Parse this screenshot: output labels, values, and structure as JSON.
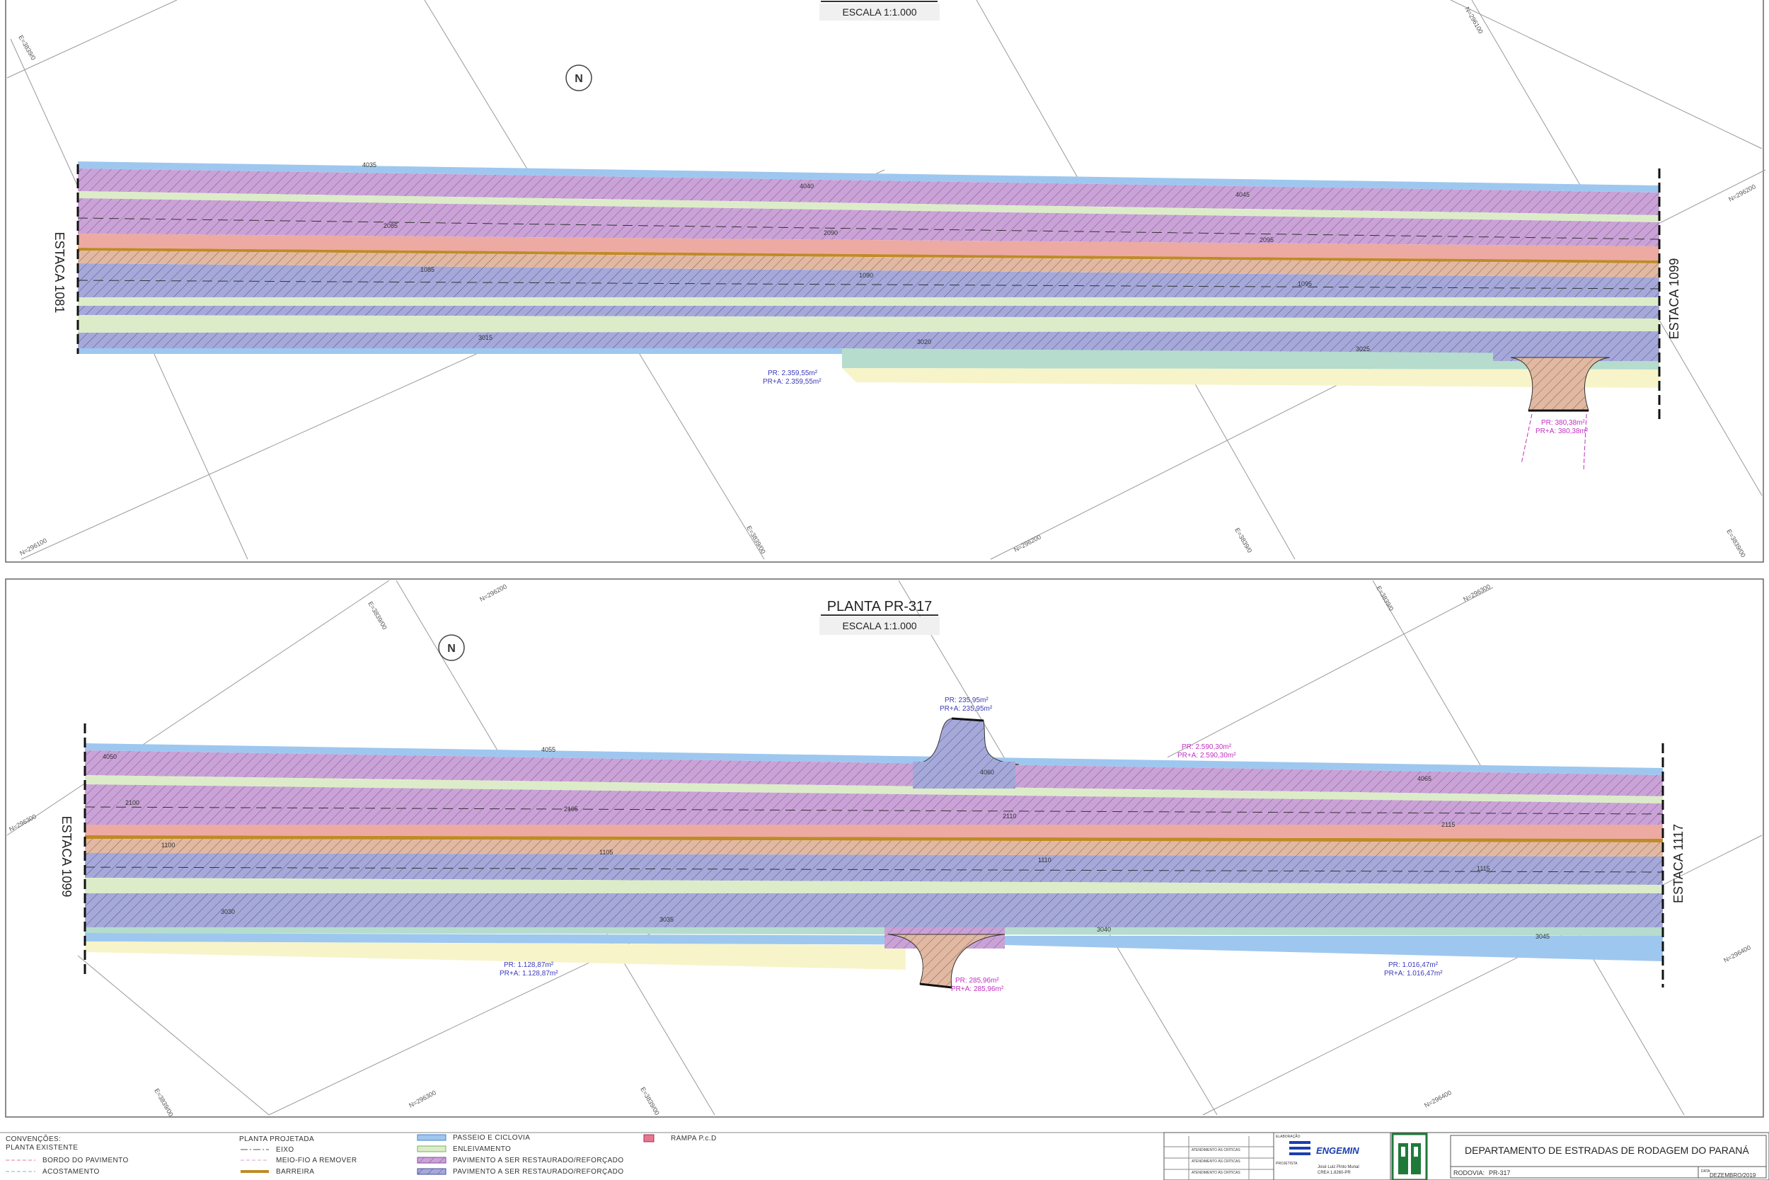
{
  "top_panel": {
    "title": "",
    "scale": "ESCALA  1:1.000",
    "left_station": "ESTACA 1081",
    "right_station": "ESTACA 1099",
    "stake_labels": [
      "4035",
      "4040",
      "4045",
      "2085",
      "2090",
      "2095",
      "1085",
      "1090",
      "1095",
      "3015",
      "3020",
      "3025"
    ],
    "area_blue": [
      "PR:  2.359,55m²",
      "PR+A:  2.359,55m²"
    ],
    "area_magenta": [
      "PR:  380,38m²",
      "PR+A:  380,38m²"
    ],
    "grid_labels": [
      "E=3839/0",
      "N=296200",
      "N=296100",
      "E=3839/00",
      "N=296200",
      "E=3839/0",
      "E=3839/00",
      "N=296100"
    ]
  },
  "bottom_panel": {
    "title": "PLANTA PR-317",
    "scale": "ESCALA  1:1.000",
    "left_station": "ESTACA 1099",
    "right_station": "ESTACA 1117",
    "stake_labels": [
      "4050",
      "4055",
      "4060",
      "4065",
      "2100",
      "2105",
      "2110",
      "2115",
      "1100",
      "1105",
      "1110",
      "1115",
      "3030",
      "3035",
      "3040",
      "3045"
    ],
    "area_top_blue": [
      "PR:  235,95m²",
      "PR+A:  235,95m²"
    ],
    "area_mid_magenta": [
      "PR:  2.590,30m²",
      "PR+A:  2.590,30m²"
    ],
    "area_left_blue": [
      "PR:  1.128,87m²",
      "PR+A:  1.128,87m²"
    ],
    "area_center_magenta": [
      "PR:  285,96m²",
      "PR+A:  285,96m²"
    ],
    "area_right_blue": [
      "PR:  1.016,47m²",
      "PR+A:  1.016,47m²"
    ],
    "grid_labels": [
      "E=3839/00",
      "N=296200",
      "E=3839/0",
      "N=296300",
      "N=296300",
      "N=296400",
      "E=3839/00",
      "N=296300",
      "E=3839/00",
      "N=296400"
    ]
  },
  "legend": {
    "existing_title": [
      "CONVENÇÕES:",
      "PLANTA  EXISTENTE"
    ],
    "existing_items": [
      "BORDO  DO  PAVIMENTO",
      "ACOSTAMENTO"
    ],
    "projected_title": "PLANTA  PROJETADA",
    "projected_items": [
      "EIXO",
      "MEIO-FIO  A  REMOVER",
      "BARREIRA"
    ],
    "fill_items": [
      "PASSEIO  E  CICLOVIA",
      "ENLEIVAMENTO",
      "PAVIMENTO  A  SER  RESTAURADO/REFORÇADO",
      "PAVIMENTO  A  SER  RESTAURADO/REFORÇADO"
    ],
    "ramp_item": "RAMPA  P.c.D"
  },
  "title_block": {
    "department": "DEPARTAMENTO DE ESTRADAS DE RODAGEM DO PARANÁ",
    "company": "ENGEMIN",
    "road_label": "RODOVIA:",
    "road_value": "PR-317",
    "date_value": "DEZEMBRO/2019",
    "revisions": [
      "ATENDIMENTO ÀS CRÍTICAS",
      "ATENDIMENTO ÀS CRÍTICAS",
      "ATENDIMENTO ÀS CRÍTICAS"
    ],
    "labels": [
      "ELABORAÇÃO",
      "PROJETISTA",
      "DATA"
    ],
    "engineer": [
      "José Luiz Pinto Munal",
      "CREA 1.8260-PR"
    ]
  },
  "colors": {
    "passeio": "#9ec7ef",
    "pavimento": "#c9a3d6",
    "pavimento_azul": "#a6a9d8",
    "enleivamento": "#dcecc8",
    "acostamento": "#f7f4c9",
    "mediana": "#ecaaa3",
    "barreira": "#c08a25",
    "area_blue": "#3a3ab8",
    "area_magenta": "#c030c0"
  }
}
